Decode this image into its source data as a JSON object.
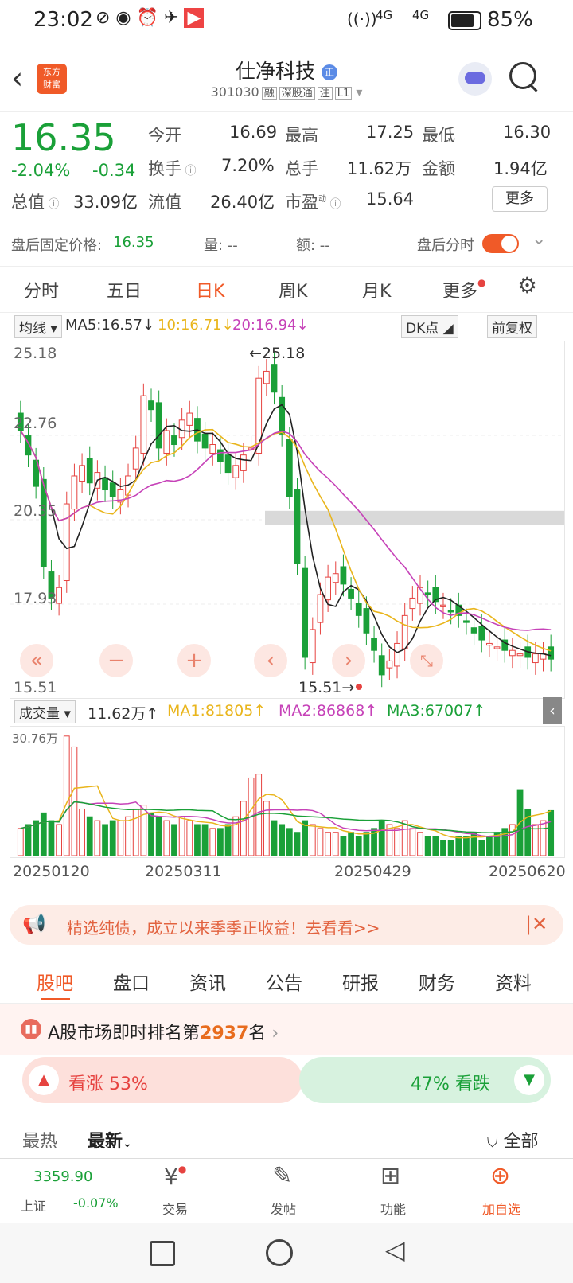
{
  "status": {
    "time": "23:02",
    "battery": "85%",
    "net1": "4G",
    "net2": "4G"
  },
  "header": {
    "logo_line1": "东方",
    "logo_line2": "财富",
    "name": "仕净科技",
    "badge": "正",
    "code": "301030",
    "tags": [
      "融",
      "深股通",
      "注",
      "L1"
    ]
  },
  "quote": {
    "price": "16.35",
    "pct": "-2.04%",
    "chg": "-0.34",
    "open_l": "今开",
    "open_v": "16.69",
    "high_l": "最高",
    "high_v": "17.25",
    "low_l": "最低",
    "low_v": "16.30",
    "turn_l": "换手",
    "turn_v": "7.20%",
    "vol_l": "总手",
    "vol_v": "11.62万",
    "amt_l": "金额",
    "amt_v": "1.94亿",
    "cap_l": "总值",
    "cap_v": "33.09亿",
    "float_l": "流值",
    "float_v": "26.40亿",
    "pe_l": "市盈",
    "pe_sup": "动",
    "pe_v": "15.64",
    "more": "更多"
  },
  "after": {
    "label": "盘后固定价格:",
    "price": "16.35",
    "vol": "量: --",
    "amt": "额: --",
    "toggle_label": "盘后分时"
  },
  "tabs": [
    "分时",
    "五日",
    "日K",
    "周K",
    "月K",
    "更多"
  ],
  "ma": {
    "selector": "均线",
    "ma5": "MA5:16.57",
    "ma10": "10:16.71",
    "ma20": "20:16.94",
    "dk": "DK点",
    "adj": "前复权"
  },
  "chart_ticks": {
    "y1": "25.18",
    "y2": "22.76",
    "y3": "20.35",
    "y4": "17.93",
    "y5": "15.51",
    "hi_note": "←25.18",
    "lo_note": "15.51→"
  },
  "volume": {
    "selector": "成交量",
    "cur": "11.62万",
    "ma1": "MA1:81805",
    "ma2": "MA2:86868",
    "ma3": "MA3:67007",
    "top": "30.76万",
    "d1": "20250120",
    "d2": "20250311",
    "d3": "20250429",
    "d4": "20250620"
  },
  "banner": {
    "text": "精选纯债，成立以来季季正收益！去看看>>"
  },
  "subtabs": [
    "股吧",
    "盘口",
    "资讯",
    "公告",
    "研报",
    "财务",
    "资料"
  ],
  "rank": {
    "pre": "A股市场即时排名第",
    "num": "2937",
    "post": "名"
  },
  "vote": {
    "up": "看涨 53%",
    "down": "47% 看跌",
    "up_frac": 0.53
  },
  "feed": {
    "hot": "最热",
    "new": "最新",
    "all": "全部"
  },
  "bottom": {
    "index_val": "3359.90",
    "index_name": "上证",
    "index_chg": "-0.07%",
    "items": [
      "交易",
      "发帖",
      "功能",
      "加自选"
    ]
  },
  "colors": {
    "up": "#e64340",
    "down": "#1aa038",
    "accent": "#f05a28"
  },
  "chart_data": {
    "type": "candlestick",
    "ylim": [
      15.51,
      25.18
    ],
    "x_ticks": [
      "20250120",
      "20250311",
      "20250429",
      "20250620"
    ],
    "close": [
      22.9,
      22.2,
      21.3,
      19.0,
      18.1,
      18.4,
      20.8,
      21.6,
      21.9,
      21.4,
      21.7,
      21.2,
      21.0,
      21.2,
      21.6,
      22.4,
      23.9,
      23.5,
      22.4,
      22.9,
      22.5,
      23.2,
      23.4,
      22.6,
      22.4,
      22.5,
      22.0,
      21.7,
      21.9,
      22.2,
      22.4,
      24.4,
      24.6,
      24.0,
      22.8,
      21.0,
      19.1,
      16.4,
      17.2,
      18.2,
      18.7,
      18.8,
      18.5,
      18.1,
      17.6,
      17.1,
      16.6,
      15.9,
      16.3,
      16.8,
      17.6,
      18.1,
      18.4,
      18.2,
      18.0,
      17.9,
      17.7,
      17.6,
      17.4,
      17.1,
      16.9,
      16.8,
      16.7,
      16.6,
      16.6,
      16.5,
      16.4,
      16.5,
      16.5,
      16.35
    ],
    "volume_wan": [
      7,
      8,
      9,
      11,
      9,
      8,
      30.8,
      28,
      12,
      10,
      9,
      8,
      9,
      9,
      10,
      12,
      13,
      11,
      10,
      9,
      8,
      10,
      9,
      8,
      8,
      7,
      7,
      8,
      10,
      14,
      20,
      21,
      14,
      9,
      8,
      7,
      6,
      9,
      8,
      7,
      6,
      6,
      5,
      6,
      5,
      6,
      7,
      9,
      8,
      7,
      9,
      7,
      6,
      5,
      5,
      4,
      4,
      5,
      5,
      6,
      4,
      5,
      6,
      7,
      8,
      17,
      12,
      8,
      9,
      11.6
    ]
  }
}
